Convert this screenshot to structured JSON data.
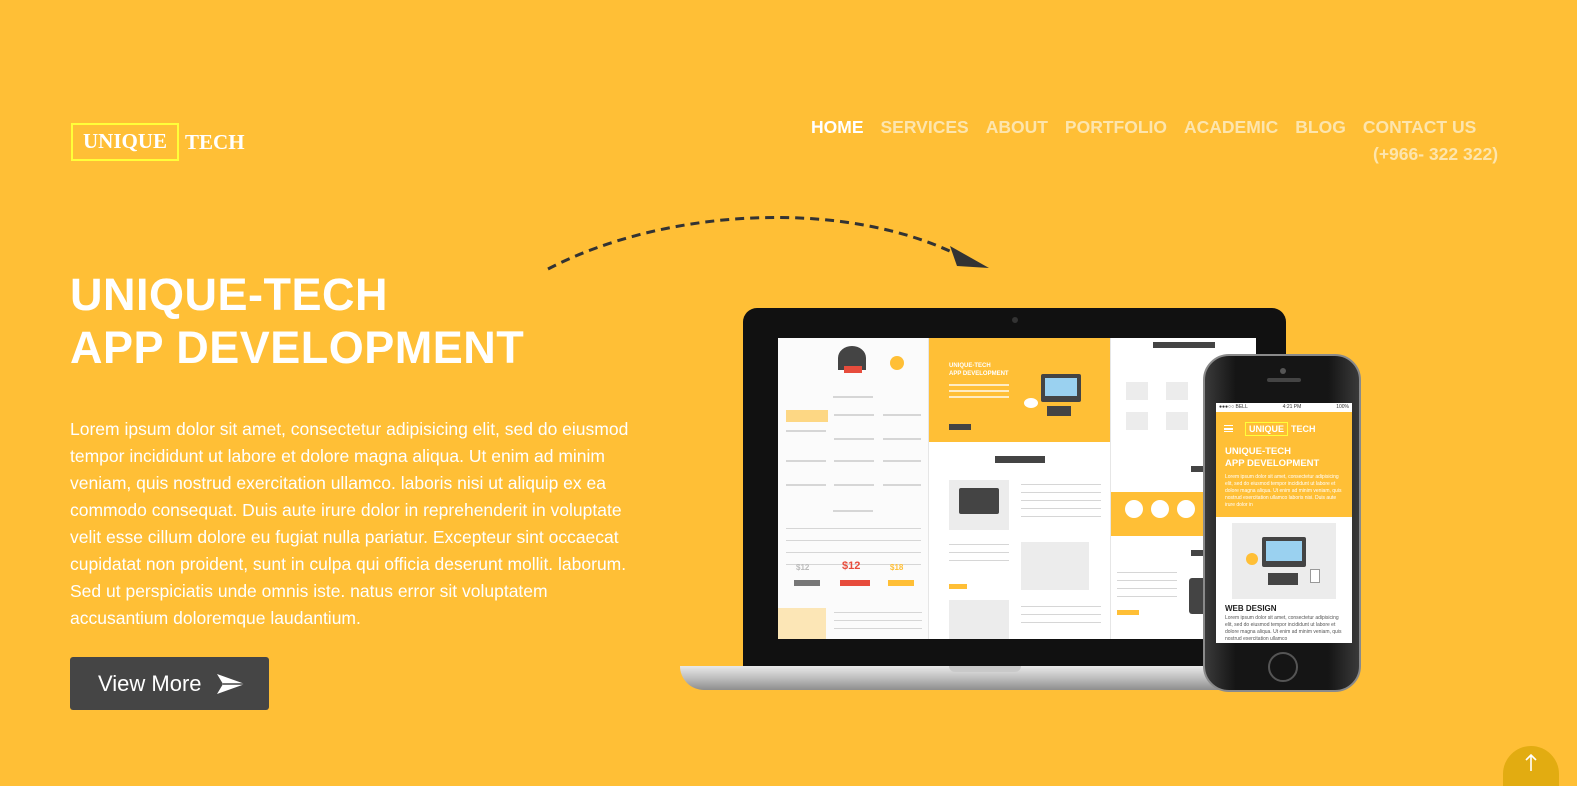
{
  "logo": {
    "boxed": "UNIQUE",
    "tail": "TECH"
  },
  "nav": {
    "items": [
      "HOME",
      "SERVICES",
      "ABOUT",
      "PORTFOLIO",
      "ACADEMIC",
      "BLOG",
      "CONTACT US"
    ],
    "active": "HOME",
    "phone": "(+966- 322 322)"
  },
  "hero": {
    "title_line1": "UNIQUE-TECH",
    "title_line2": "APP DEVELOPMENT",
    "description": "Lorem ipsum dolor sit amet, consectetur adipisicing elit, sed do eiusmod tempor incididunt ut labore et dolore magna aliqua. Ut enim ad minim veniam, quis nostrud exercitation ullamco. laboris nisi ut aliquip ex ea commodo consequat. Duis aute irure dolor in reprehenderit in voluptate velit esse cillum dolore eu fugiat nulla pariatur. Excepteur sint occaecat cupidatat non proident, sunt in culpa qui officia deserunt mollit. laborum. Sed ut perspiciatis unde omnis iste. natus error sit voluptatem accusantium doloremque laudantium.",
    "button_label": "View More"
  },
  "mockup_phone": {
    "status_left": "●●●○○ BELL",
    "status_time": "4:21 PM",
    "status_right": "100%",
    "logo_boxed": "UNIQUE",
    "logo_tail": "TECH",
    "title_line1": "UNIQUE-TECH",
    "title_line2": "APP DEVELOPMENT",
    "hero_text": "Lorem ipsum dolor sit amet, consectetur adipisicing elit, sed do eiusmod tempor incididunt ut labore et dolore magna aliqua. Ut enim ad minim veniam, quis nostrud exercitation ullamco laboris nisi. Duis aute irure dolor in",
    "section_title": "WEB DESIGN",
    "section_text": "Lorem ipsum dolor sit amet, consectetur adipisicing elit, sed do eiusmod tempor incididunt ut labore et dolore magna aliqua. Ut enim ad minim veniam, quis nostrud exercitation ullamco"
  },
  "mockup_laptop": {
    "title_line1": "UNIQUE-TECH",
    "title_line2": "APP DEVELOPMENT",
    "prices": [
      "$12",
      "$18"
    ]
  },
  "colors": {
    "background": "#ffbf36",
    "button": "#454545",
    "logo_border": "#ffff3a",
    "scroll_top": "#e2ac11"
  }
}
